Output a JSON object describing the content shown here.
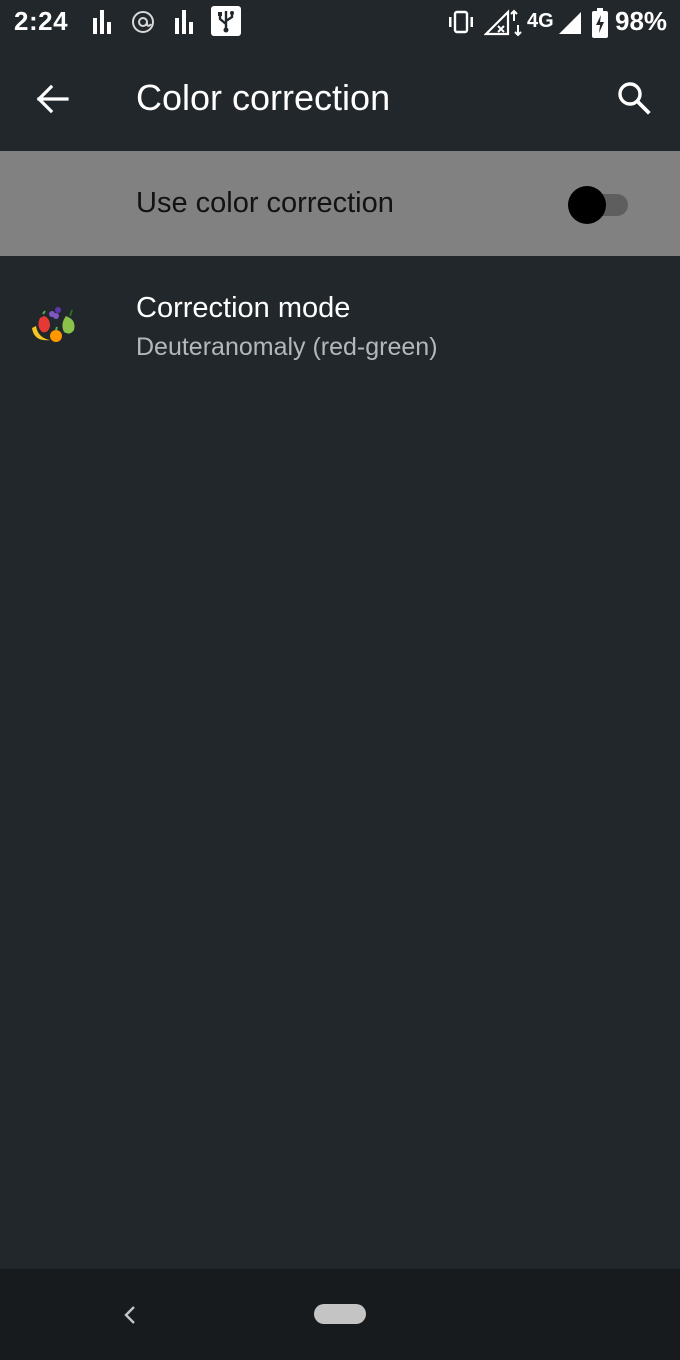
{
  "status_bar": {
    "time": "2:24",
    "network": "4G",
    "battery": "98%",
    "icons": [
      "bars-icon",
      "at-sign-icon",
      "bars-icon",
      "usb-icon",
      "vibrate-icon",
      "no-signal-icon",
      "signal-icon",
      "battery-charging-icon"
    ]
  },
  "app_bar": {
    "title": "Color correction",
    "back_icon": "arrow-left-icon",
    "search_icon": "search-icon"
  },
  "toggle": {
    "label": "Use color correction",
    "checked": false
  },
  "correction_mode": {
    "title": "Correction mode",
    "summary": "Deuteranomaly (red-green)",
    "icon": "fruit-icon"
  },
  "nav_bar": {
    "back_icon": "chevron-left-icon",
    "home_icon": "home-pill-icon"
  },
  "colors": {
    "background": "#22272b",
    "toggle_row_highlight": "#818181",
    "nav_bar": "#171b1e"
  }
}
